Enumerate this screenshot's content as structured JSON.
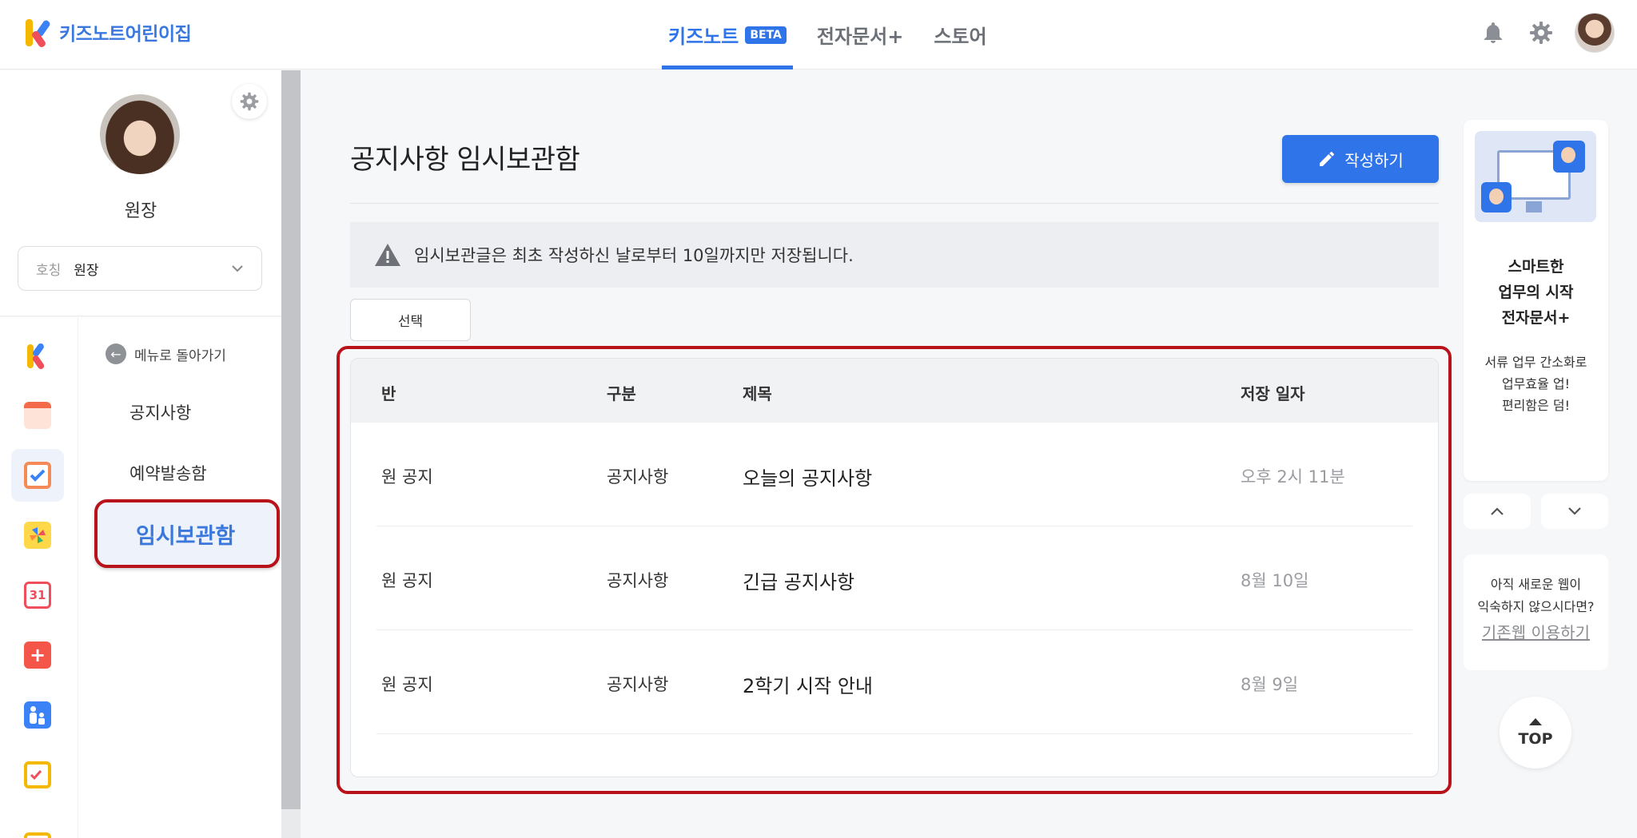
{
  "app": {
    "brand": "키즈노트어린이집",
    "nav_tabs": [
      {
        "label": "키즈노트",
        "badge": "BETA",
        "active": true
      },
      {
        "label": "전자문서+",
        "active": false
      },
      {
        "label": "스토어",
        "active": false
      }
    ]
  },
  "profile": {
    "name": "원장",
    "title_label": "호칭",
    "title_value": "원장"
  },
  "rail": {
    "icons": [
      "kidsnote-logo-icon",
      "calendar-note-icon",
      "checklist-icon",
      "pinwheel-icon",
      "calendar-31-icon",
      "medicine-icon",
      "parent-child-icon",
      "report-icon"
    ],
    "calendar_day": "31"
  },
  "submenu": {
    "back_label": "메뉴로 돌아가기",
    "items": [
      "공지사항",
      "예약발송함",
      "임시보관함"
    ],
    "active": "임시보관함"
  },
  "main": {
    "title": "공지사항 임시보관함",
    "write_button": "작성하기",
    "notice": "임시보관글은 최초 작성하신 날로부터 10일까지만 저장됩니다.",
    "select_button": "선택",
    "table": {
      "headers": [
        "반",
        "구분",
        "제목",
        "저장 일자"
      ],
      "rows": [
        {
          "class": "원 공지",
          "category": "공지사항",
          "title": "오늘의 공지사항",
          "date": "오후 2시 11분"
        },
        {
          "class": "원 공지",
          "category": "공지사항",
          "title": "긴급 공지사항",
          "date": "8월 10일"
        },
        {
          "class": "원 공지",
          "category": "공지사항",
          "title": "2학기 시작 안내",
          "date": "8월 9일"
        }
      ]
    }
  },
  "sidebar_right": {
    "ad_headline": [
      "스마트한",
      "업무의 시작",
      "전자문서+"
    ],
    "ad_sub": [
      "서류 업무 간소화로",
      "업무효율 업!",
      "편리함은 덤!"
    ],
    "legacy_text": [
      "아직 새로운 웹이",
      "익숙하지 않으시다면?"
    ],
    "legacy_link": "기존웹 이용하기",
    "top_label": "TOP"
  },
  "colors": {
    "accent": "#2f74e8",
    "highlight": "#b8121b",
    "active_bg": "#eef2fb"
  }
}
